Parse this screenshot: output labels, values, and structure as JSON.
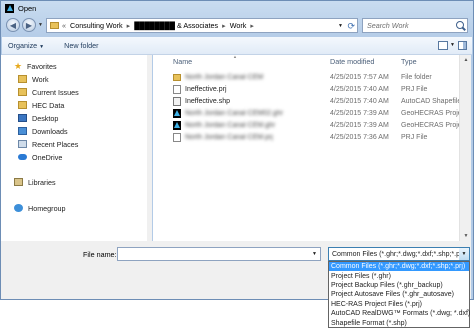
{
  "window": {
    "title": "Open"
  },
  "address": {
    "prefix": "«",
    "crumbs": [
      "Consulting Work",
      "████████ & Associates",
      "Work"
    ],
    "search_placeholder": "Search Work"
  },
  "toolbar": {
    "organize": "Organize",
    "new_folder": "New folder"
  },
  "nav": {
    "favorites_label": "Favorites",
    "favorites": [
      "Work",
      "Current Issues",
      "HEC Data",
      "Desktop",
      "Downloads",
      "Recent Places",
      "OneDrive"
    ],
    "libraries_label": "Libraries",
    "homegroup_label": "Homegroup"
  },
  "columns": {
    "name": "Name",
    "date": "Date modified",
    "type": "Type"
  },
  "files": [
    {
      "name": "North Jordan Canal CEM",
      "blurred": true,
      "date": "4/25/2015 7:57 AM",
      "type": "File folder",
      "icon": "folder-icon"
    },
    {
      "name": "Ineffective.prj",
      "blurred": false,
      "date": "4/25/2015 7:40 AM",
      "type": "PRJ File",
      "icon": "prj-file-icon"
    },
    {
      "name": "Ineffective.shp",
      "blurred": false,
      "date": "4/25/2015 7:40 AM",
      "type": "AutoCAD Shapefile",
      "icon": "shp-file-icon"
    },
    {
      "name": "North Jordan Canal CEM02.ghr",
      "blurred": true,
      "date": "4/25/2015 7:39 AM",
      "type": "GeoHECRAS Project",
      "icon": "ghr-file-icon"
    },
    {
      "name": "North Jordan Canal CEM.ghr",
      "blurred": true,
      "date": "4/25/2015 7:39 AM",
      "type": "GeoHECRAS Project",
      "icon": "ghr-file-icon"
    },
    {
      "name": "North Jordan Canal CEM.prj",
      "blurred": true,
      "date": "4/25/2015 7:36 AM",
      "type": "PRJ File",
      "icon": "prj-file-icon"
    }
  ],
  "bottom": {
    "file_name_label": "File name:",
    "file_name_value": "",
    "type_selected": "Common Files (*.ghr;*.dwg;*.dxf;*.shp;*.prj)"
  },
  "type_options": [
    "Common Files (*.ghr;*.dwg;*.dxf;*.shp;*.prj)",
    "Project Files (*.ghr)",
    "Project Backup Files (*.ghr_backup)",
    "Project Autosave Files (*.ghr_autosave)",
    "HEC-RAS Project Files (*.prj)",
    "AutoCAD RealDWG™ Formats (*.dwg; *.dxf)",
    "Shapefile Format (*.shp)"
  ],
  "colors": {
    "selection": "#3399ff",
    "chrome": "#b3cbe7"
  }
}
